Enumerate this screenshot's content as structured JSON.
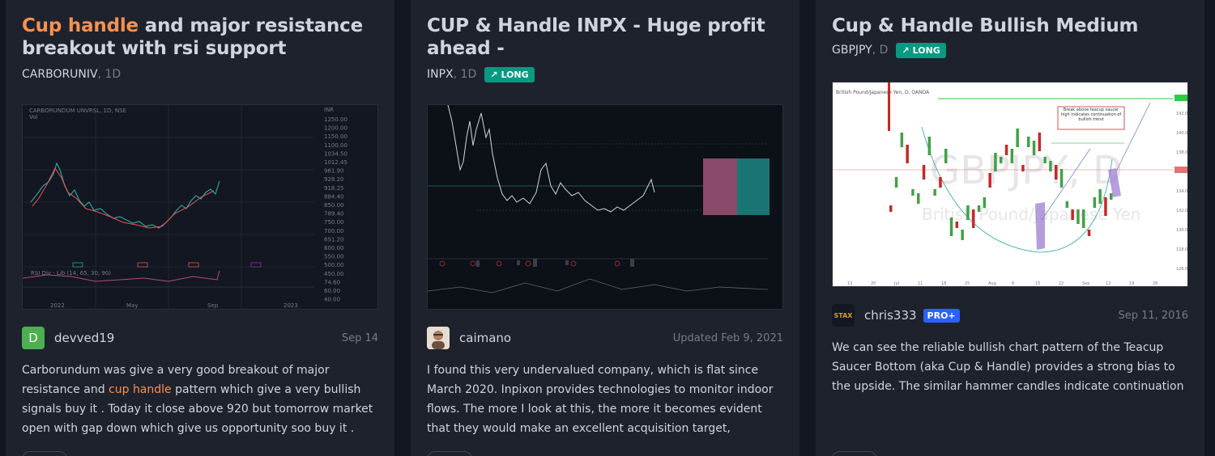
{
  "cards": [
    {
      "title_hl": "Cup handle",
      "title_rest": " and major resistance breakout with rsi support",
      "symbol": "CARBORUNIV",
      "timeframe": ", 1D",
      "author": "devved19",
      "avatar_letter": "D",
      "date": "Sep 14",
      "desc_1": "Carborundum was give a very good breakout of major resistance and ",
      "desc_hl": "cup handle",
      "desc_2": " pattern which give a very bullish signals buy it . Today it close above 920 but tomorrow market open with gap down which give us opportunity soo buy it . Buy carborundum a...",
      "chart": {
        "header": "CARBORUNDUM UNVRSL, 1D, NSE",
        "vol": "Vol",
        "currency": "INR",
        "prices": [
          "1250.00",
          "1200.00",
          "1150.00",
          "1100.00",
          "1034.50",
          "1012.45",
          "961.90",
          "928.20",
          "918.25",
          "884.40",
          "850.00",
          "789.40",
          "750.00",
          "700.00",
          "651.20",
          "600.00",
          "550.00",
          "500.00",
          "450.00",
          "74.60",
          "60.00",
          "40.00"
        ],
        "x_labels": [
          "2022",
          "May",
          "Sep",
          "2023"
        ],
        "rsi_label": "RSI Div - Lib (14, 65, 30, 90)"
      }
    },
    {
      "title": "CUP & Handle INPX - Huge profit ahead -",
      "symbol": "INPX",
      "timeframe": ", 1D",
      "badge": "LONG",
      "author": "caimano",
      "date": "Updated Feb 9, 2021",
      "desc": "I found this very undervalued company, which is flat since March 2020. Inpixon provides technologies to monitor indoor flows. The more I look at this, the more it becomes evident that they would make an excellent acquisition target, technology-rich, cash on..."
    },
    {
      "title": "Cup & Handle Bullish Medium Term",
      "symbol": "GBPJPY",
      "timeframe": ", D",
      "badge": "LONG",
      "author": "chris333",
      "avatar_text": "STAX",
      "pro": "PRO+",
      "date": "Sep 11, 2016",
      "desc": "We can see the reliable bullish chart pattern of the Teacup Saucer Bottom (aka Cup & Handle) provides a strong bias to the upside. The similar hammer candles indicate continuation to the upside, post retracement. A break above the saucer high with a...",
      "chart": {
        "header": "British Pound/Japanese Yen, D, OANDA",
        "watermark": "GBPJPY, D",
        "watermark_sub": "British Pound/Japanese Yen",
        "callout": "Break above teacup saucer high indicates continuation of bullish trend",
        "prices": [
          "142.00",
          "140.00",
          "138.00",
          "136.00",
          "134.00",
          "132.00",
          "130.00",
          "128.00",
          "126.00"
        ],
        "x_labels": [
          "13",
          "20",
          "Jul",
          "11",
          "18",
          "25",
          "Aug",
          "8",
          "15",
          "22",
          "Sep",
          "12",
          "19",
          "26"
        ]
      }
    }
  ],
  "colors": {
    "long": "#089981",
    "highlight": "#f7914e",
    "pro": "#2962ff"
  }
}
